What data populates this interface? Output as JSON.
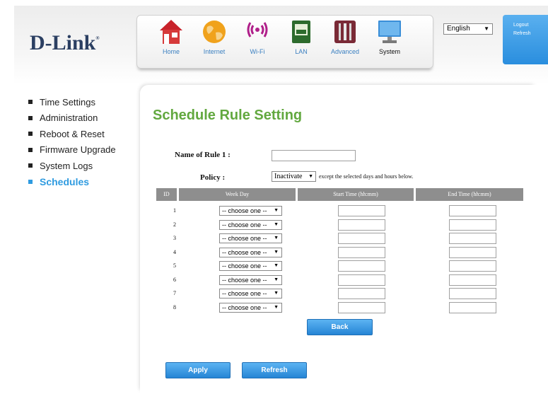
{
  "brand": {
    "logo_text": "D-Link",
    "logo_mark": "®"
  },
  "nav": [
    {
      "label": "Home",
      "icon": "home-icon"
    },
    {
      "label": "Internet",
      "icon": "globe-icon"
    },
    {
      "label": "Wi-Fi",
      "icon": "wifi-icon"
    },
    {
      "label": "LAN",
      "icon": "lan-icon"
    },
    {
      "label": "Advanced",
      "icon": "tools-icon"
    },
    {
      "label": "System",
      "icon": "computer-icon"
    }
  ],
  "nav_active": "System",
  "language": {
    "selected": "English"
  },
  "account": {
    "logout_label": "Logout",
    "refresh_label": "Refresh"
  },
  "sidebar": {
    "items": [
      {
        "label": "Time Settings"
      },
      {
        "label": "Administration"
      },
      {
        "label": "Reboot & Reset"
      },
      {
        "label": "Firmware Upgrade"
      },
      {
        "label": "System Logs"
      },
      {
        "label": "Schedules"
      }
    ],
    "active": "Schedules"
  },
  "page": {
    "title": "Schedule Rule Setting"
  },
  "form": {
    "rule_name_label": "Name of Rule  1 :",
    "rule_name_value": "",
    "policy_label": "Policy :",
    "policy_selected": "Inactivate",
    "policy_note": "except the selected days and hours below."
  },
  "table": {
    "headers": [
      "ID",
      "Week Day",
      "Start Time (hh:mm)",
      "End Time (hh:mm)"
    ],
    "rows": [
      {
        "id": "1",
        "weekday": "-- choose one --",
        "start": "",
        "end": ""
      },
      {
        "id": "2",
        "weekday": "-- choose one --",
        "start": "",
        "end": ""
      },
      {
        "id": "3",
        "weekday": "-- choose one --",
        "start": "",
        "end": ""
      },
      {
        "id": "4",
        "weekday": "-- choose one --",
        "start": "",
        "end": ""
      },
      {
        "id": "5",
        "weekday": "-- choose one --",
        "start": "",
        "end": ""
      },
      {
        "id": "6",
        "weekday": "-- choose one --",
        "start": "",
        "end": ""
      },
      {
        "id": "7",
        "weekday": "-- choose one --",
        "start": "",
        "end": ""
      },
      {
        "id": "8",
        "weekday": "-- choose one --",
        "start": "",
        "end": ""
      }
    ]
  },
  "buttons": {
    "back": "Back",
    "apply": "Apply",
    "refresh": "Refresh"
  },
  "colors": {
    "title_green": "#62a83f",
    "accent_blue": "#2f9be0",
    "button_blue": "#2585d5",
    "header_gray": "#8e8e8e",
    "logo_navy": "#2b3f62"
  }
}
